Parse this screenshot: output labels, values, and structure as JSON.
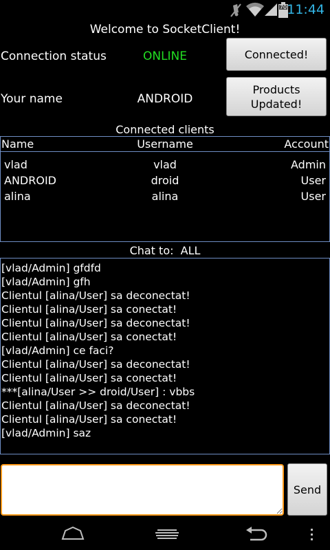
{
  "status_bar": {
    "time": "11:44",
    "battery_level": "70",
    "icons": [
      "mute-icon",
      "wifi-icon",
      "signal-icon",
      "battery-icon"
    ]
  },
  "header": {
    "title": "Welcome to SocketClient!"
  },
  "connection": {
    "label": "Connection status",
    "value": "ONLINE",
    "value_color": "#22dd22",
    "button_label": "Connected!"
  },
  "user": {
    "label": "Your name",
    "value": "ANDROID",
    "button_label": "Products Updated!"
  },
  "clients": {
    "section_title": "Connected clients",
    "columns": [
      "Name",
      "Username",
      "Account"
    ],
    "rows": [
      {
        "name": "vlad",
        "username": "vlad",
        "account": "Admin"
      },
      {
        "name": "ANDROID",
        "username": "droid",
        "account": "User"
      },
      {
        "name": "alina",
        "username": "alina",
        "account": "User"
      }
    ]
  },
  "chat": {
    "target_label": "Chat to:  ALL",
    "messages": [
      "[vlad/Admin] gfdfd",
      "[vlad/Admin] gfh",
      "Clientul [alina/User] sa deconectat!",
      "Clientul [alina/User] sa conectat!",
      "Clientul [alina/User] sa deconectat!",
      "Clientul [alina/User] sa conectat!",
      "[vlad/Admin] ce faci?",
      "Clientul [alina/User] sa deconectat!",
      "Clientul [alina/User] sa conectat!",
      "***[alina/User >> droid/User] : vbbs",
      "Clientul [alina/User] sa deconectat!",
      "Clientul [alina/User] sa conectat!",
      "[vlad/Admin] saz"
    ]
  },
  "composer": {
    "input_value": "",
    "send_label": "Send"
  },
  "colors": {
    "accent_blue": "#33b5e5",
    "border_blue": "#6f8ec5",
    "input_focus": "#ff9a1a",
    "online_green": "#22dd22"
  }
}
